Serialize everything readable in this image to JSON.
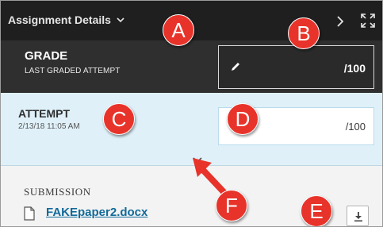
{
  "header": {
    "title": "Assignment Details",
    "icons": {
      "dropdown": "chevron-down-icon",
      "next": "chevron-right-icon",
      "expand": "expand-icon"
    }
  },
  "grade": {
    "title": "GRADE",
    "subtitle": "LAST GRADED ATTEMPT",
    "out_of": "/100",
    "edit_icon": "pencil-icon"
  },
  "attempt": {
    "title": "ATTEMPT",
    "date": "2/13/18 11:05 AM",
    "out_of": "/100"
  },
  "submission": {
    "label": "SUBMISSION",
    "file_name": "FAKEpaper2.docx",
    "file_icon": "document-icon",
    "download_icon": "download-icon"
  },
  "callouts": [
    "A",
    "B",
    "C",
    "D",
    "E",
    "F"
  ],
  "colors": {
    "header_bg": "#1f1f1f",
    "grade_bg": "#2f2f2f",
    "attempt_bg": "#dff0f8",
    "submission_bg": "#f3f3f3",
    "link": "#126a9a",
    "callout": "#e8332a"
  }
}
